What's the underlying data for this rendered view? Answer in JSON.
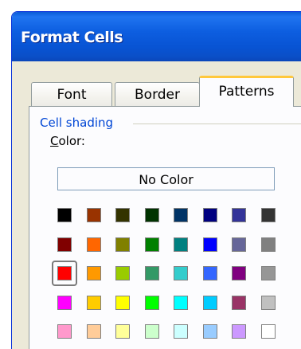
{
  "window": {
    "title": "Format Cells"
  },
  "tabs": [
    {
      "label": "Font",
      "active": false
    },
    {
      "label": "Border",
      "active": false
    },
    {
      "label": "Patterns",
      "active": true
    }
  ],
  "cell_shading": {
    "group_label": "Cell shading",
    "color_label_mnemonic": "C",
    "color_label_rest": "olor:",
    "no_color_button": "No Color",
    "selected_color": "#ff0000",
    "palette": [
      [
        "#000000",
        "#993300",
        "#333300",
        "#003300",
        "#003366",
        "#000080",
        "#333399",
        "#333333"
      ],
      [
        "#800000",
        "#ff6600",
        "#808000",
        "#008000",
        "#008080",
        "#0000ff",
        "#666699",
        "#808080"
      ],
      [
        "#ff0000",
        "#ff9900",
        "#99cc00",
        "#339966",
        "#33cccc",
        "#3366ff",
        "#800080",
        "#969696"
      ],
      [
        "#ff00ff",
        "#ffcc00",
        "#ffff00",
        "#00ff00",
        "#00ffff",
        "#00ccff",
        "#993366",
        "#c0c0c0"
      ],
      [
        "#ff99cc",
        "#ffcc99",
        "#ffff99",
        "#ccffcc",
        "#ccffff",
        "#99ccff",
        "#cc99ff",
        "#ffffff"
      ]
    ]
  }
}
